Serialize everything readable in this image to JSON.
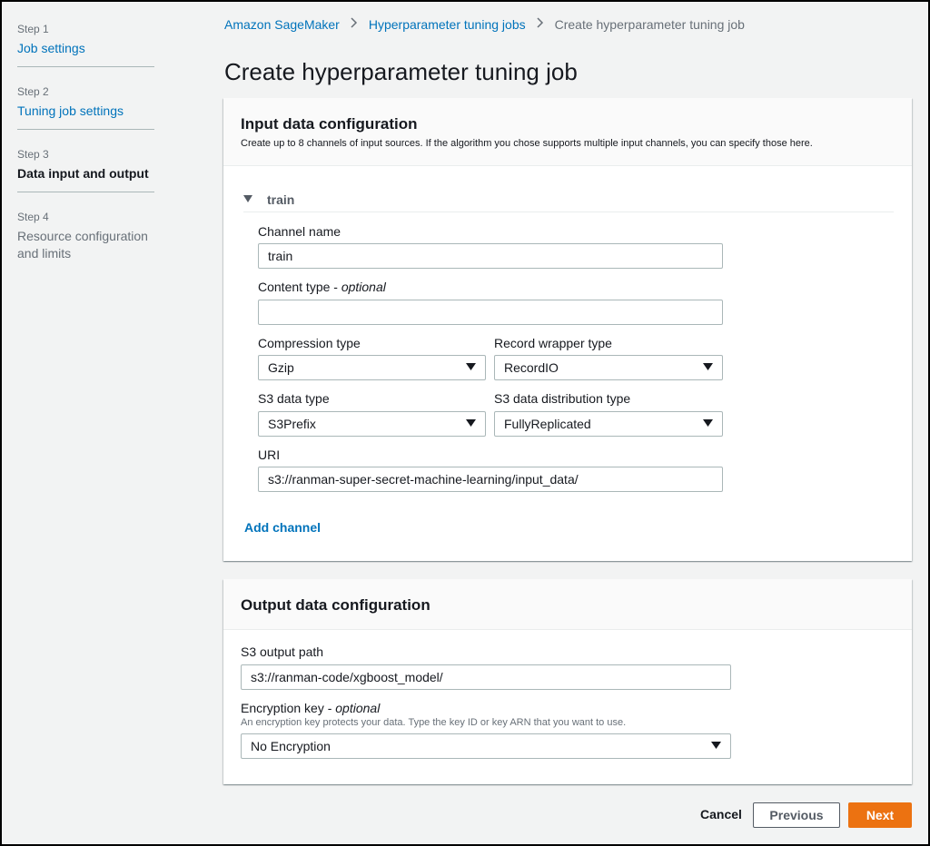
{
  "sidebar": {
    "steps": [
      {
        "num": "Step 1",
        "label": "Job settings"
      },
      {
        "num": "Step 2",
        "label": "Tuning job settings"
      },
      {
        "num": "Step 3",
        "label": "Data input and output"
      },
      {
        "num": "Step 4",
        "label": "Resource configuration and limits"
      }
    ]
  },
  "breadcrumb": {
    "items": [
      "Amazon SageMaker",
      "Hyperparameter tuning jobs"
    ],
    "current": "Create hyperparameter tuning job",
    "separator": ">"
  },
  "page": {
    "title": "Create hyperparameter tuning job"
  },
  "input_config": {
    "title": "Input data configuration",
    "description": "Create up to 8 channels of input sources. If the algorithm you chose supports multiple input channels, you can specify those here.",
    "channel": {
      "title": "train",
      "channel_name_label": "Channel name",
      "channel_name_value": "train",
      "content_type_label": "Content type -",
      "content_type_optional": "optional",
      "content_type_value": "",
      "compression_label": "Compression type",
      "compression_value": "Gzip",
      "record_wrapper_label": "Record wrapper type",
      "record_wrapper_value": "RecordIO",
      "s3_data_type_label": "S3 data type",
      "s3_data_type_value": "S3Prefix",
      "s3_distribution_label": "S3 data distribution type",
      "s3_distribution_value": "FullyReplicated",
      "uri_label": "URI",
      "uri_value": "s3://ranman-super-secret-machine-learning/input_data/"
    },
    "add_channel": "Add channel"
  },
  "output_config": {
    "title": "Output data configuration",
    "s3_output_label": "S3 output path",
    "s3_output_value": "s3://ranman-code/xgboost_model/",
    "encryption_label": "Encryption key -",
    "encryption_optional": "optional",
    "encryption_hint": "An encryption key protects your data. Type the key ID or key ARN that you want to use.",
    "encryption_value": "No Encryption"
  },
  "footer": {
    "cancel": "Cancel",
    "previous": "Previous",
    "next": "Next"
  },
  "colors": {
    "link": "#0073bb",
    "primary_button": "#ec7211",
    "background": "#f2f3f3"
  },
  "icons": {
    "breadcrumb_separator": "chevron-right-icon",
    "channel_toggle": "caret-down-icon",
    "select_arrow": "caret-down-icon"
  }
}
